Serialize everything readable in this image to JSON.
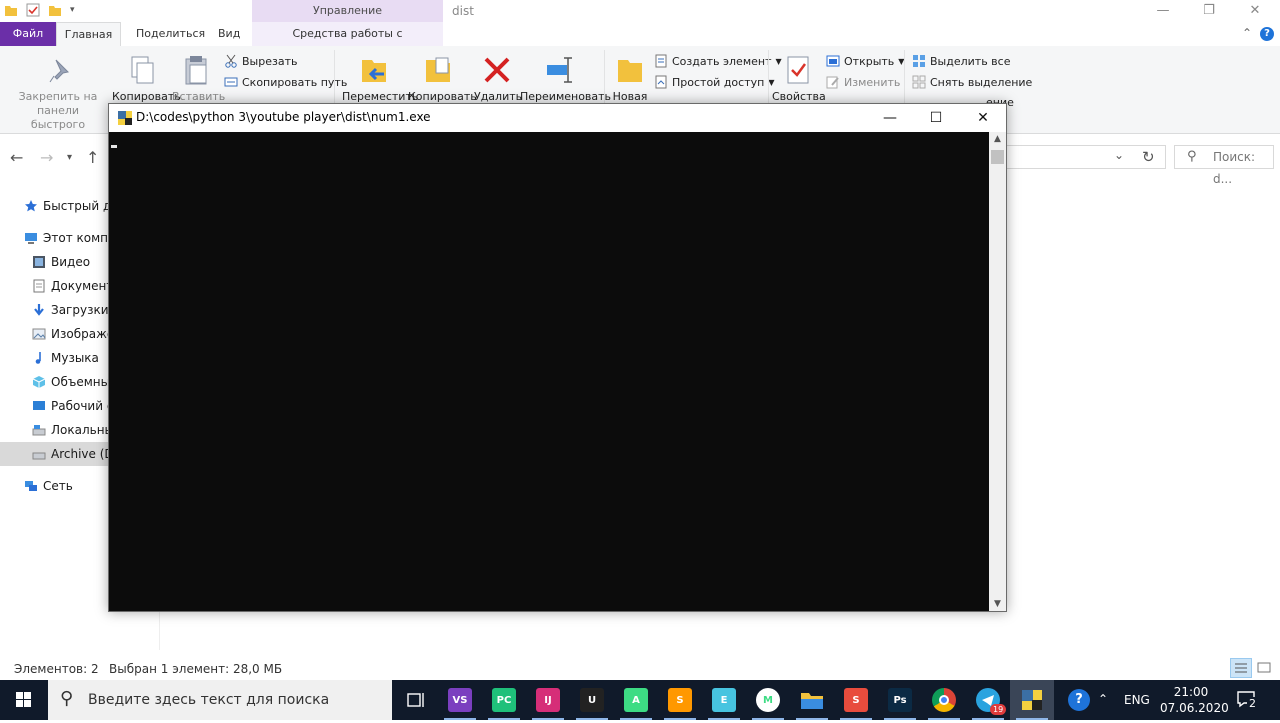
{
  "explorer": {
    "folder_title": "dist",
    "context_tab_header": "Управление",
    "tabs": {
      "file": "Файл",
      "home": "Главная",
      "share": "Поделиться",
      "view": "Вид",
      "app_tools": "Средства работы с приложениями"
    },
    "ribbon": {
      "pin_line1": "Закрепить на панели",
      "pin_line2": "быстрого доступа",
      "copy": "Копировать",
      "paste": "Вставить",
      "cut": "Вырезать",
      "copy_path": "Скопировать путь",
      "move": "Переместить",
      "copy_to": "Копировать",
      "delete": "Удалить",
      "rename": "Переименовать",
      "new_folder": "Новая",
      "new_item": "Создать элемент",
      "easy_access": "Простой доступ",
      "properties": "Свойства",
      "open": "Открыть",
      "edit": "Изменить",
      "select_all": "Выделить все",
      "select_none": "Снять выделение",
      "invert_selection_partial": "ение"
    },
    "search_placeholder": "Поиск: d...",
    "nav_items": [
      "Быстрый до",
      "Этот компь",
      "Видео",
      "Документ",
      "Загрузки",
      "Изображе",
      "Музыка",
      "Объемные",
      "Рабочий с",
      "Локальны",
      "Archive (D:",
      "Сеть"
    ],
    "status": {
      "item_count": "Элементов: 2",
      "selected": "Выбран 1 элемент: 28,0 МБ"
    }
  },
  "console": {
    "title": "D:\\codes\\python 3\\youtube player\\dist\\num1.exe"
  },
  "taskbar": {
    "search_placeholder": "Введите здесь текст для поиска",
    "language": "ENG",
    "time": "21:00",
    "date": "07.06.2020",
    "telegram_badge": "19",
    "notification_count": "2",
    "apps": [
      {
        "name": "task-view",
        "label": "",
        "color": "#101a2a"
      },
      {
        "name": "visual-studio",
        "label": "VS",
        "color": "#7b3fbf"
      },
      {
        "name": "pycharm",
        "label": "PC",
        "color": "#1fc07a"
      },
      {
        "name": "intellij",
        "label": "IJ",
        "color": "#d62e78"
      },
      {
        "name": "unity",
        "label": "U",
        "color": "#222222"
      },
      {
        "name": "android-studio",
        "label": "A",
        "color": "#3ddc84"
      },
      {
        "name": "sublime-text",
        "label": "S",
        "color": "#ff9800"
      },
      {
        "name": "electron-app",
        "label": "E",
        "color": "#47c4e0"
      },
      {
        "name": "maps-app",
        "label": "M",
        "color": "#ffffff"
      },
      {
        "name": "file-explorer",
        "label": "",
        "color": "#f2c13d"
      },
      {
        "name": "swift-app",
        "label": "S",
        "color": "#e84c3d"
      },
      {
        "name": "photoshop",
        "label": "Ps",
        "color": "#0b2a44"
      },
      {
        "name": "chrome",
        "label": "",
        "color": "#db4437"
      },
      {
        "name": "telegram",
        "label": "",
        "color": "#2aa3df"
      },
      {
        "name": "python-console",
        "label": "",
        "color": "#3b6fa4"
      },
      {
        "name": "help-app",
        "label": "?",
        "color": "#1e73d9"
      }
    ]
  }
}
